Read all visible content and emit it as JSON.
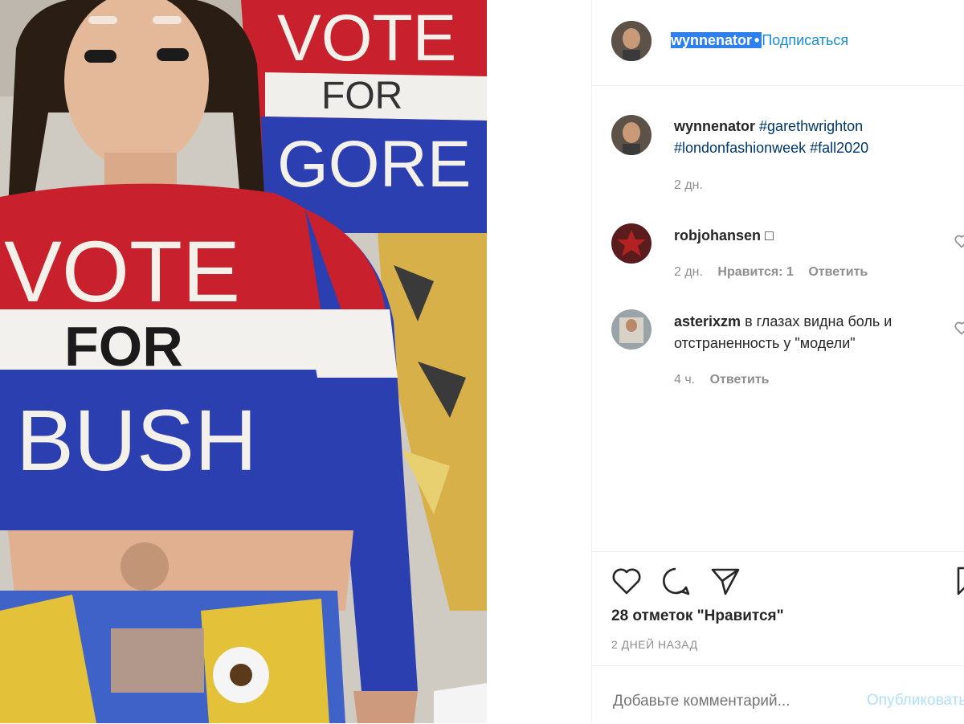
{
  "header": {
    "username": "wynnenator",
    "separator": "•",
    "follow_label": "Подписаться"
  },
  "caption": {
    "username": "wynnenator",
    "text": "#garethwrighton #londonfashionweek #fall2020",
    "time": "2 дн."
  },
  "comments": [
    {
      "username": "robjohansen",
      "text": "□",
      "time": "2 дн.",
      "likes": "Нравится: 1",
      "reply": "Ответить"
    },
    {
      "username": "asterixzm",
      "text": "в глазах видна боль и отстраненность у \"модели\"",
      "time": "4 ч.",
      "reply": "Ответить"
    }
  ],
  "photo": {
    "sweater_front": [
      "VOTE",
      "FOR",
      "BUSH"
    ],
    "sweater_back": [
      "VOTE",
      "FOR",
      "GORE"
    ]
  },
  "likes_text": "28 отметок \"Нравится\"",
  "date_text": "2 ДНЕЙ НАЗАД",
  "add_comment": {
    "placeholder": "Добавьте комментарий...",
    "post_label": "Опубликовать"
  },
  "colors": {
    "sweater_red": "#c8202c",
    "sweater_blue": "#2b3fb0",
    "link_blue": "#1a8cd8",
    "selection": "#2f80ed"
  }
}
